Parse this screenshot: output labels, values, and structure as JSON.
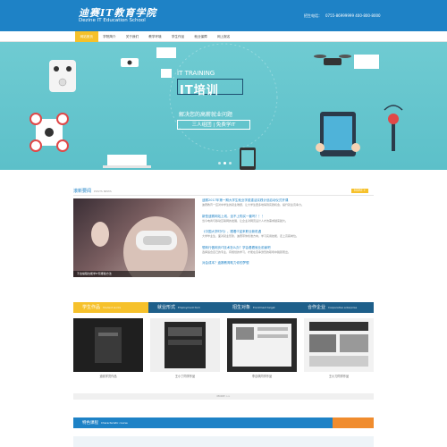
{
  "header": {
    "logo_cn": "迪赛IT教育学院",
    "logo_en": "Dezine IT Education School",
    "hotline_label": "招生电话：",
    "hotline_numbers": "0755-86999999  400-800-8000"
  },
  "nav": {
    "items": [
      "网站首页",
      "学院简介",
      "关于我们",
      "教学环境",
      "学生作品",
      "就业保障",
      "网上报名"
    ]
  },
  "banner": {
    "headline": "IT TRAINING",
    "title": "IT培训",
    "subtitle": "解决您的高薪就业问题",
    "tag": "三人组团 | 免费学IT"
  },
  "news": {
    "title": "滚新要闻",
    "title_en": "POSTS NEWS",
    "more": "MORE +",
    "photo_caption": "不会编程也能学IT有哪些方法",
    "items": [
      {
        "headline": "迪赛2017年第一期大学生就业学费重活实践计划启动仪式开课",
        "body": "迪赛教育一应对中学生的就业难题，让大学生更多地得到实践机会，提升就业竞争力。"
      },
      {
        "headline": "新型迪赛网站上线，坐不上购买一套吗？！！",
        "body": "当今电商与移动互联网的发展，让企业对网页设计人才的需求越来越大。"
      },
      {
        "headline": "《中国大学时代》，跟着IT迎来职业新机遇",
        "body": "大学毕业生，面对就业形势，迪赛带你找准方向，学习实用技能，走上高薪岗位。"
      },
      {
        "headline": "想转行做网页IT技术怎么办？学会看看就业前景吧",
        "body": "选择适合自己的专业，有规划的学习，才能在竞争激烈的职场中脱颖而出。"
      },
      {
        "headline": "对会成本？迪赛教育助力你的梦想",
        "body": ""
      }
    ]
  },
  "works": {
    "tabs": [
      {
        "label": "学生作品",
        "sub": "Student works"
      },
      {
        "label": "就业形式",
        "sub": "Employment form"
      },
      {
        "label": "招生对象",
        "sub": "Enrollment target"
      },
      {
        "label": "合作企业",
        "sub": "Cooperative enterprise"
      }
    ],
    "items": [
      {
        "caption": "迪赛学员作品"
      },
      {
        "caption": "王小丁同学作品"
      },
      {
        "caption": "李嘉琪同学作品"
      },
      {
        "caption": "王小刀同学作品"
      }
    ],
    "more": "MORE >>"
  },
  "feature": {
    "title": "特色课程",
    "title_en": "Characteristic course"
  },
  "colors": {
    "primary": "#1e82c6",
    "accent": "#f6c12b",
    "banner_bg": "#5cc0c9",
    "dark_tab": "#1e5f8a",
    "orange": "#f08c2e"
  }
}
